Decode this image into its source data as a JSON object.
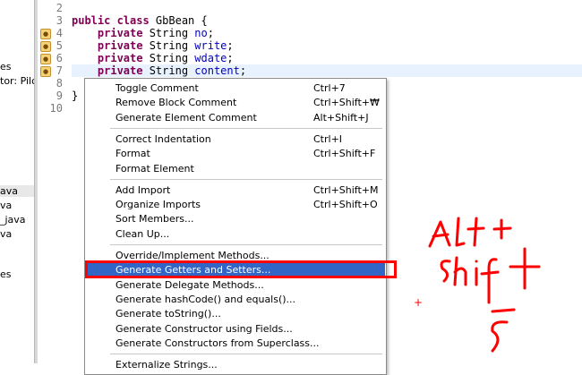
{
  "explorer": {
    "items": [
      "es",
      "tor: Pilo",
      "ava",
      "va",
      "_java",
      "va",
      "es"
    ]
  },
  "editor": {
    "lines": [
      {
        "num": "2",
        "marker": false
      },
      {
        "num": "3",
        "marker": false
      },
      {
        "num": "4",
        "marker": true
      },
      {
        "num": "5",
        "marker": true
      },
      {
        "num": "6",
        "marker": true
      },
      {
        "num": "7",
        "marker": true
      },
      {
        "num": "8",
        "marker": false
      },
      {
        "num": "9",
        "marker": false
      },
      {
        "num": "10",
        "marker": false
      }
    ],
    "class_decl": {
      "kw": "public class",
      "name": " GbBean {"
    },
    "fields": [
      {
        "kw": "private",
        "type": " String ",
        "name": "no",
        "end": ";"
      },
      {
        "kw": "private",
        "type": " String ",
        "name": "write",
        "end": ";"
      },
      {
        "kw": "private",
        "type": " String ",
        "name": "wdate",
        "end": ";"
      },
      {
        "kw": "private",
        "type": " String ",
        "name": "content",
        "end": ";"
      }
    ],
    "close_brace": "}"
  },
  "menu": {
    "items": [
      {
        "label": "Toggle Comment",
        "shortcut": "Ctrl+7"
      },
      {
        "label": "Remove Block Comment",
        "shortcut": "Ctrl+Shift+₩"
      },
      {
        "label": "Generate Element Comment",
        "shortcut": "Alt+Shift+J"
      },
      {
        "label": "Correct Indentation",
        "shortcut": "Ctrl+I"
      },
      {
        "label": "Format",
        "shortcut": "Ctrl+Shift+F"
      },
      {
        "label": "Format Element",
        "shortcut": ""
      },
      {
        "label": "Add Import",
        "shortcut": "Ctrl+Shift+M"
      },
      {
        "label": "Organize Imports",
        "shortcut": "Ctrl+Shift+O"
      },
      {
        "label": "Sort Members...",
        "shortcut": ""
      },
      {
        "label": "Clean Up...",
        "shortcut": ""
      },
      {
        "label": "Override/Implement Methods...",
        "shortcut": ""
      },
      {
        "label": "Generate Getters and Setters...",
        "shortcut": "",
        "selected": true
      },
      {
        "label": "Generate Delegate Methods...",
        "shortcut": ""
      },
      {
        "label": "Generate hashCode() and equals()...",
        "shortcut": ""
      },
      {
        "label": "Generate toString()...",
        "shortcut": ""
      },
      {
        "label": "Generate Constructor using Fields...",
        "shortcut": ""
      },
      {
        "label": "Generate Constructors from Superclass...",
        "shortcut": ""
      },
      {
        "label": "Externalize Strings...",
        "shortcut": ""
      }
    ]
  },
  "annotation": {
    "color": "#ff0000",
    "line1": "Alt+",
    "line2": "shift",
    "line3": "+",
    "line4": "S"
  }
}
